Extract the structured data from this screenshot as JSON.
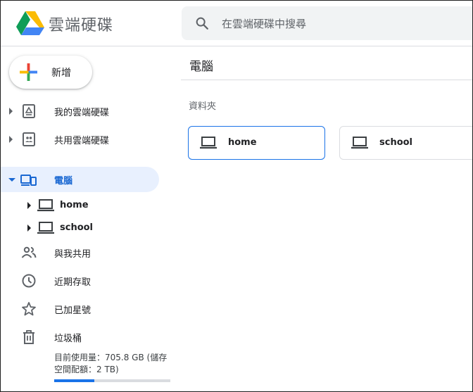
{
  "header": {
    "app_title": "雲端硬碟",
    "search_placeholder": "在雲端硬碟中搜尋"
  },
  "sidebar": {
    "new_button": "新增",
    "items": [
      {
        "label": "我的雲端硬碟",
        "icon": "my-drive-icon"
      },
      {
        "label": "共用雲端硬碟",
        "icon": "shared-drives-icon"
      },
      {
        "label": "電腦",
        "icon": "computers-icon"
      },
      {
        "label": "與我共用",
        "icon": "people-icon"
      },
      {
        "label": "近期存取",
        "icon": "clock-icon"
      },
      {
        "label": "已加星號",
        "icon": "star-icon"
      },
      {
        "label": "垃圾桶",
        "icon": "trash-icon"
      }
    ],
    "computers": [
      {
        "label": "home",
        "icon": "laptop-icon"
      },
      {
        "label": "school",
        "icon": "laptop-icon"
      }
    ],
    "storage": {
      "text": "目前使用量：705.8 GB (儲存空間配額：2 TB)",
      "used_fraction": 0.345
    }
  },
  "main": {
    "title": "電腦",
    "section_label": "資料夾",
    "folders": [
      {
        "label": "home",
        "selected": true
      },
      {
        "label": "school",
        "selected": false
      }
    ]
  },
  "colors": {
    "accent": "#1a73e8",
    "active_bg": "#e8f0fe",
    "active_text": "#1967d2"
  }
}
